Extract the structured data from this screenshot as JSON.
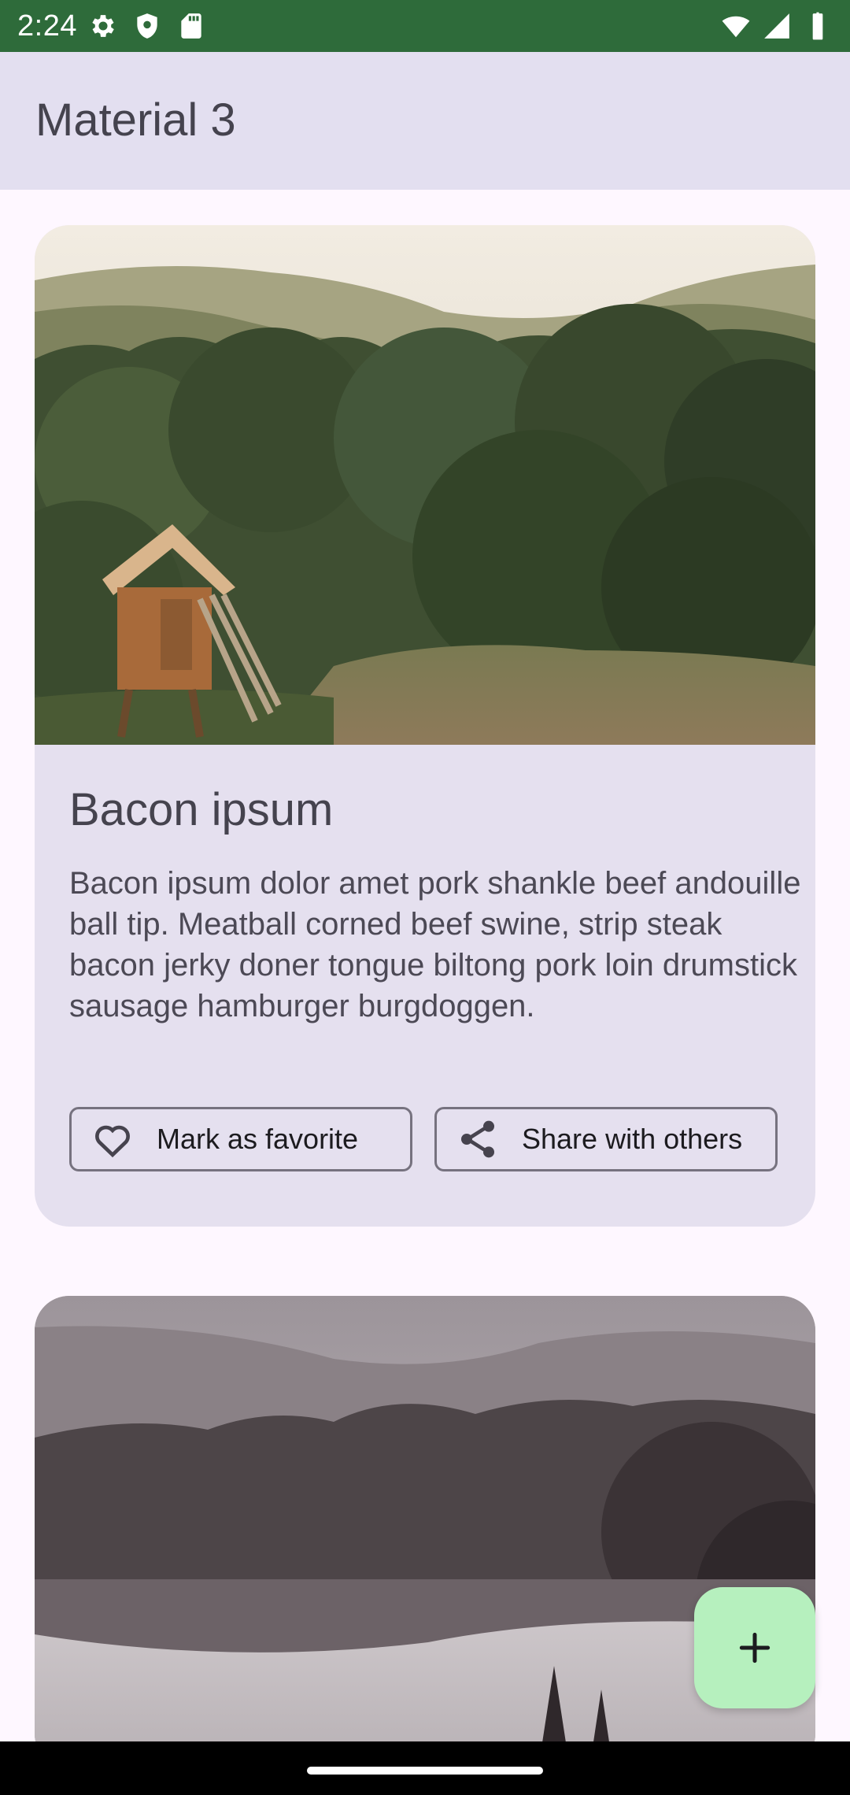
{
  "status_bar": {
    "time": "2:24",
    "left_icons": [
      "gear-icon",
      "shield-icon",
      "sd-card-icon"
    ],
    "right_icons": [
      "wifi-icon",
      "signal-icon",
      "battery-icon"
    ],
    "color": "#2E6B3A"
  },
  "app_bar": {
    "title": "Material 3",
    "color": "#E3DFF0"
  },
  "cards": [
    {
      "image": "forest-cabin-photo",
      "title": "Bacon ipsum",
      "body": "Bacon ipsum dolor amet pork shankle beef andouille ball tip. Meatball corned beef swine, strip steak bacon jerky doner tongue biltong pork loin drumstick sausage hamburger burgdoggen.",
      "buttons": [
        {
          "label": "Mark as favorite",
          "icon": "heart-outline-icon"
        },
        {
          "label": "Share with others",
          "icon": "share-icon"
        }
      ]
    },
    {
      "image": "misty-lake-forest-photo"
    }
  ],
  "fab": {
    "icon": "plus-icon",
    "color": "#B6F0BE"
  },
  "colors": {
    "background": "#FEF7FF",
    "card": "#E5E0EF",
    "outline": "#76727F"
  }
}
